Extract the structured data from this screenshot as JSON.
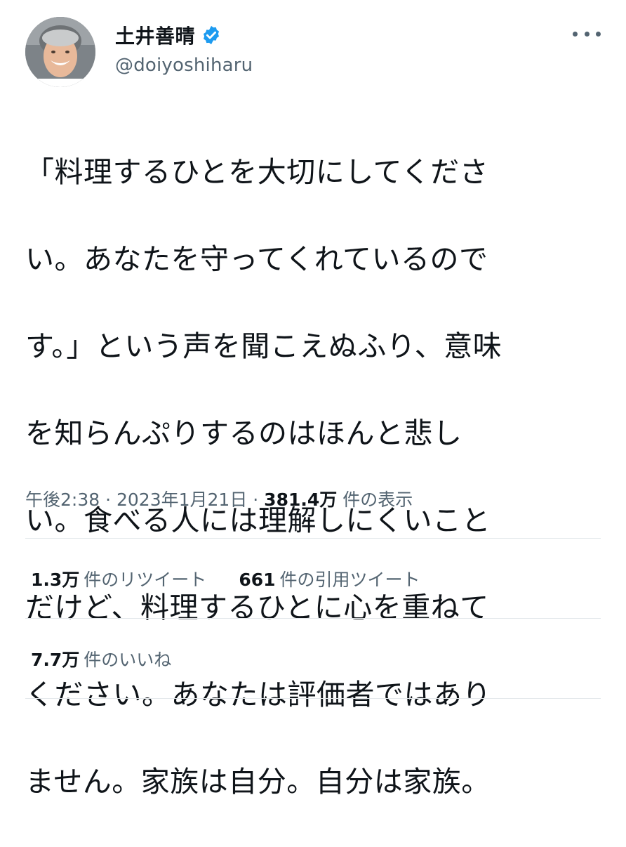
{
  "user": {
    "display_name": "土井善晴",
    "handle": "@doiyoshiharu",
    "verified_icon": "verified-badge-icon",
    "badge_color": "#1d9bf0"
  },
  "tweet": {
    "lines": [
      "「料理するひとを大切にしてくださ",
      "い。あなたを守ってくれているので",
      "す。」という声を聞こえぬふり、意味",
      "を知らんぷりするのはほんと悲し",
      "い。食べる人には理解しにくいこと",
      "だけど、料理するひとに心を重ねて",
      "ください。あなたは評価者ではあり",
      "ません。家族は自分。自分は家族。"
    ]
  },
  "meta": {
    "time": "午後2:38",
    "separator": " · ",
    "date": "2023年1月21日",
    "views_count": "381.4万",
    "views_label": " 件の表示"
  },
  "stats": {
    "retweets_count": "1.3万",
    "retweets_label": "件のリツイート",
    "quotes_count": "661",
    "quotes_label": "件の引用ツイート",
    "likes_count": "7.7万",
    "likes_label": "件のいいね"
  },
  "colors": {
    "text": "#0f1419",
    "secondary": "#536471",
    "divider": "#e3e8eb"
  }
}
